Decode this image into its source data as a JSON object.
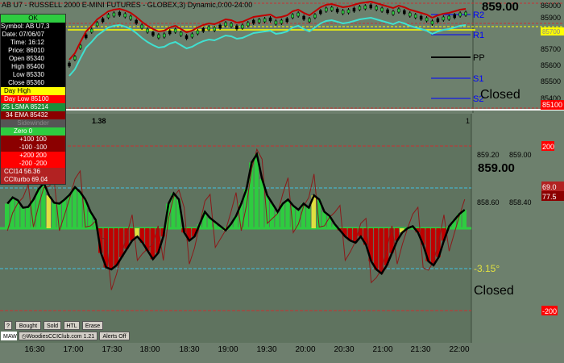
{
  "window": {
    "title": "AB U7 - RUSSELL 2000 E-MINI FUTURES - GLOBEX,3) Dynamic,0:00-24:00",
    "current_price": "859.00"
  },
  "price_pane": {
    "axis_labels": [
      "86000",
      "85900",
      "85800",
      "85700",
      "85600",
      "85500",
      "85400",
      "85300",
      "85200"
    ],
    "badge_value": "85100",
    "highlight_value": "85700",
    "pivot_labels": {
      "r2": "R2",
      "r1": "R1",
      "pp": "PP",
      "s1": "S1",
      "s2": "S2"
    },
    "status_text": "Closed"
  },
  "data_box": {
    "ok_label": "OK",
    "symbol": "Symbol: AB U7,3",
    "date": "Date: 07/06/07",
    "time": "Time: 16:12",
    "price": "Price: 86010",
    "open": "Open 85340",
    "high": "High 85400",
    "low": "Low 85330",
    "close": "Close 85360",
    "day_high": "Day High",
    "day_low": "Day Low 85100",
    "lsma": "25 LSMA 85214",
    "ema": "34 EMA 85432",
    "sidewinder": "Sidewinder",
    "zero": "Zero 0",
    "plus100": "+100 100",
    "minus100": "-100 -100",
    "plus200": "+200 200",
    "minus200": "-200 -200",
    "cci14": "CCI14 56.36",
    "cciturbo": "CCIturbo 69.04"
  },
  "cci_pane": {
    "header_value": "1.38",
    "pane_number": "1",
    "readouts": [
      "859.20",
      "859.00",
      "858.60",
      "858.40"
    ],
    "big_price": "859.00",
    "cci_value_label": "-3.15°",
    "status_text": "Closed",
    "right_badges": {
      "plus200": "200",
      "cci": "69.0",
      "cci2": "77.5",
      "minus200": "-200"
    }
  },
  "toolbar": {
    "buttons": [
      "?",
      "Bought",
      "Sold",
      "HTL",
      "Erase"
    ],
    "brand": "WoodiesCCIClub.com 1.21",
    "alerts": "Alerts Off",
    "maw": "MAW"
  },
  "x_axis": {
    "ticks": [
      "16:30",
      "17:00",
      "17:30",
      "18:00",
      "18:30",
      "19:00",
      "19:30",
      "20:00",
      "20:30",
      "21:00",
      "21:30",
      "22:00"
    ]
  },
  "colors": {
    "pane_bg": "#6d806d",
    "green_hist": "#2ecc40",
    "red_hist": "#c00000",
    "cci_line": "#000000",
    "turbo_line": "#8b1a1a",
    "lsma": "#40e0d0",
    "ema": "#c00000",
    "pivot": "#0000ff",
    "pp": "#000000"
  }
}
